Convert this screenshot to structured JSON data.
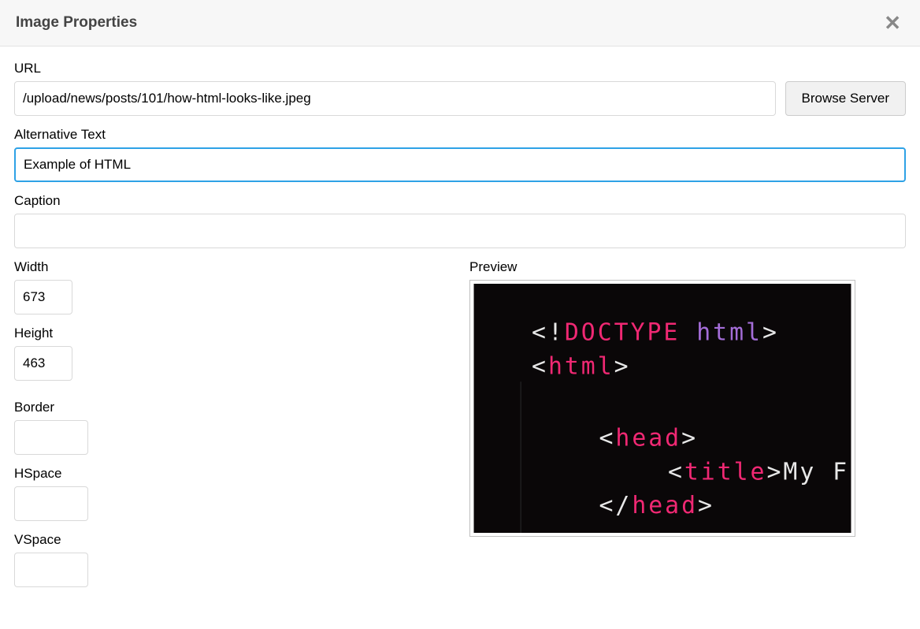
{
  "header": {
    "title": "Image Properties"
  },
  "fields": {
    "url_label": "URL",
    "url_value": "/upload/news/posts/101/how-html-looks-like.jpeg",
    "browse_button": "Browse Server",
    "alt_label": "Alternative Text",
    "alt_value": "Example of HTML",
    "caption_label": "Caption",
    "caption_value": "",
    "width_label": "Width",
    "width_value": "673",
    "height_label": "Height",
    "height_value": "463",
    "border_label": "Border",
    "border_value": "",
    "hspace_label": "HSpace",
    "hspace_value": "",
    "vspace_label": "VSpace",
    "vspace_value": "",
    "preview_label": "Preview"
  },
  "preview_code": {
    "line1_bracket_open": "<",
    "line1_bang": "!",
    "line1_doctype": "DOCTYPE",
    "line1_html": "html",
    "line1_bracket_close": ">",
    "line2_open": "<",
    "line2_tag": "html",
    "line2_close": ">",
    "line3_open": "<",
    "line3_tag": "head",
    "line3_close": ">",
    "line4_open": "<",
    "line4_tag": "title",
    "line4_close": ">",
    "line4_text": "My F",
    "line5_open": "</",
    "line5_tag": "head",
    "line5_close": ">"
  }
}
